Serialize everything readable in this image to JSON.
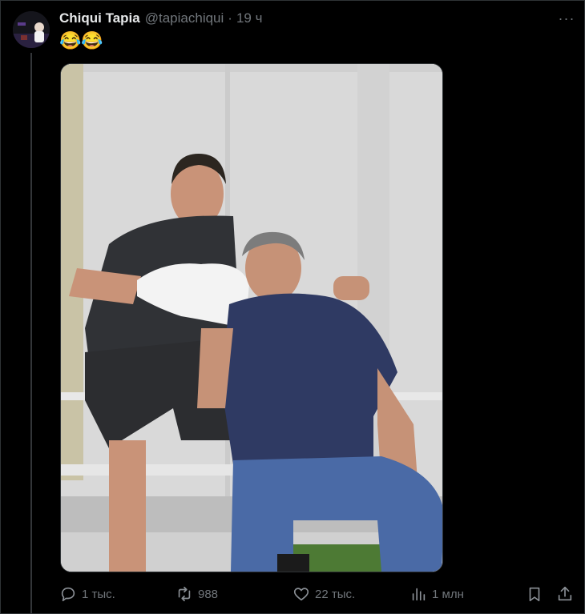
{
  "post": {
    "author_name": "Chiqui Tapia",
    "handle": "@tapiachiqui",
    "separator": "·",
    "time": "19 ч",
    "text": "😂😂",
    "more_glyph": "···"
  },
  "actions": {
    "replies": "1 тыс.",
    "reposts": "988",
    "likes": "22 тыс.",
    "views": "1 млн"
  },
  "icons": {
    "reply": "reply-icon",
    "repost": "repost-icon",
    "like": "heart-icon",
    "views": "views-icon",
    "bookmark": "bookmark-icon",
    "share": "share-icon",
    "more": "more-icon"
  },
  "colors": {
    "background": "#000000",
    "text_primary": "#e7e9ea",
    "text_secondary": "#71767b",
    "border": "#2f3336"
  }
}
